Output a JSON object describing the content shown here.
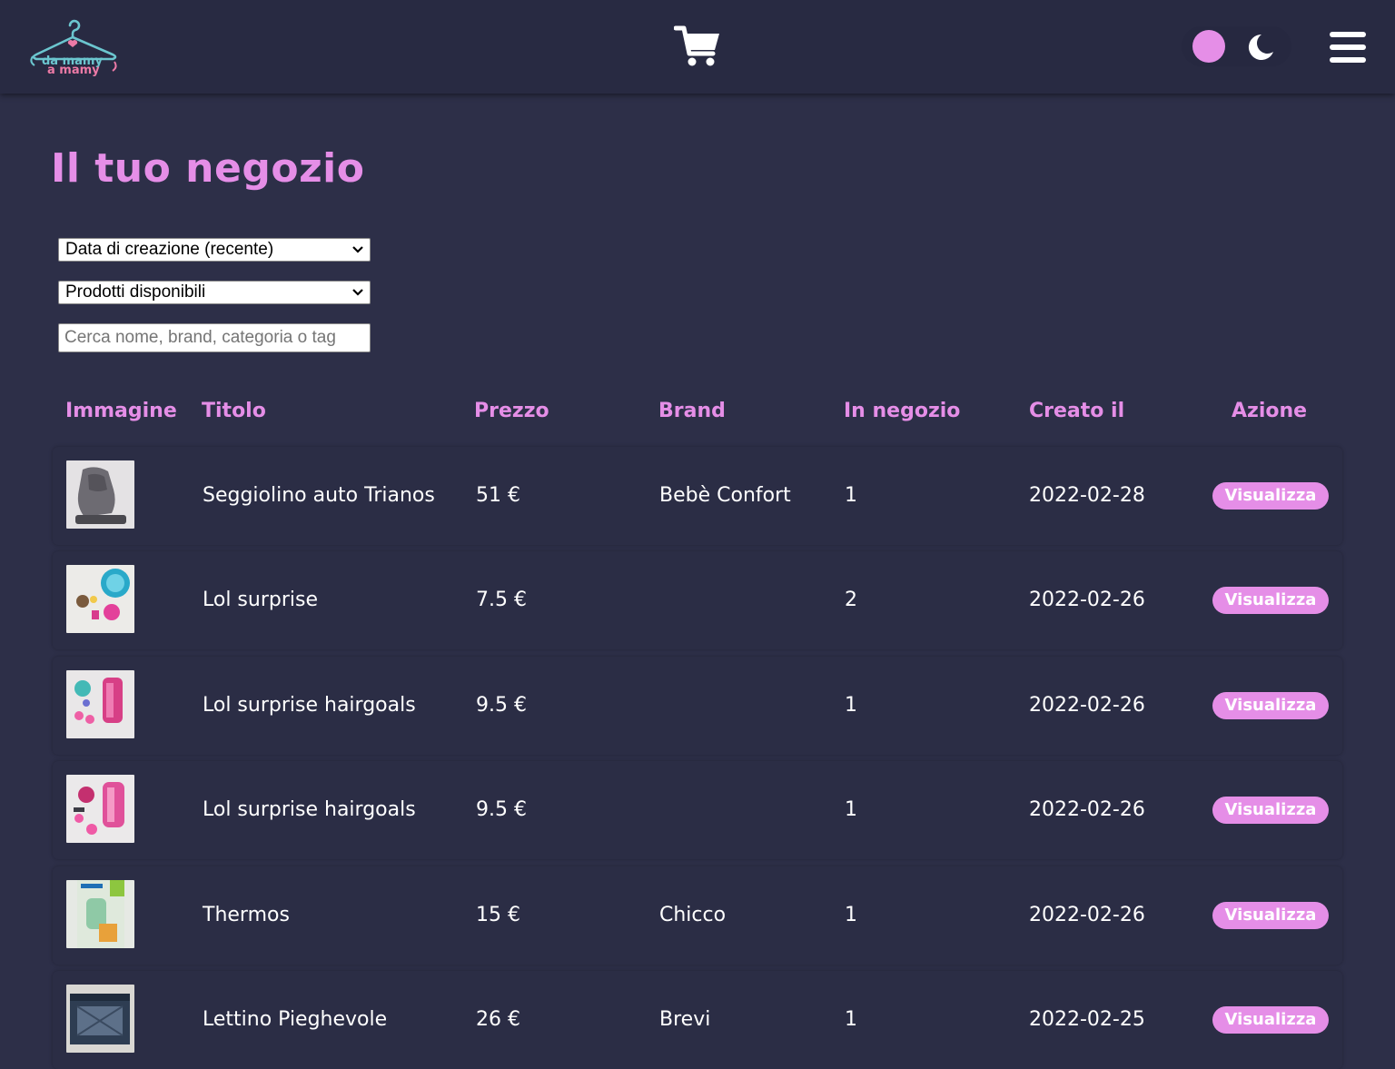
{
  "header": {
    "logo_line1": "da mamy",
    "logo_line2": "a mamy",
    "logo_icon": "hanger-logo",
    "cart_icon": "cart-icon",
    "theme_icon": "moon-icon",
    "menu_icon": "hamburger-icon"
  },
  "page": {
    "title": "Il tuo negozio"
  },
  "filters": {
    "sort_selected": "Data di creazione (recente)",
    "availability_selected": "Prodotti disponibili",
    "search_placeholder": "Cerca nome, brand, categoria o tag",
    "search_value": ""
  },
  "table": {
    "headers": {
      "image": "Immagine",
      "title": "Titolo",
      "price": "Prezzo",
      "brand": "Brand",
      "in_shop": "In negozio",
      "created": "Creato il",
      "action": "Azione"
    },
    "rows": [
      {
        "title": "Seggiolino auto Trianos",
        "price": "51 €",
        "brand": "Bebè Confort",
        "in_shop": "1",
        "created": "2022-02-28",
        "action": "Visualizza"
      },
      {
        "title": "Lol surprise",
        "price": "7.5 €",
        "brand": "",
        "in_shop": "2",
        "created": "2022-02-26",
        "action": "Visualizza"
      },
      {
        "title": "Lol surprise hairgoals",
        "price": "9.5 €",
        "brand": "",
        "in_shop": "1",
        "created": "2022-02-26",
        "action": "Visualizza"
      },
      {
        "title": "Lol surprise hairgoals",
        "price": "9.5 €",
        "brand": "",
        "in_shop": "1",
        "created": "2022-02-26",
        "action": "Visualizza"
      },
      {
        "title": "Thermos",
        "price": "15 €",
        "brand": "Chicco",
        "in_shop": "1",
        "created": "2022-02-26",
        "action": "Visualizza"
      },
      {
        "title": "Lettino Pieghevole",
        "price": "26 €",
        "brand": "Brevi",
        "in_shop": "1",
        "created": "2022-02-25",
        "action": "Visualizza"
      }
    ]
  },
  "colors": {
    "background": "#2d2f48",
    "header_bg": "#282a42",
    "accent": "#e58ee7",
    "text": "#ffffff"
  }
}
